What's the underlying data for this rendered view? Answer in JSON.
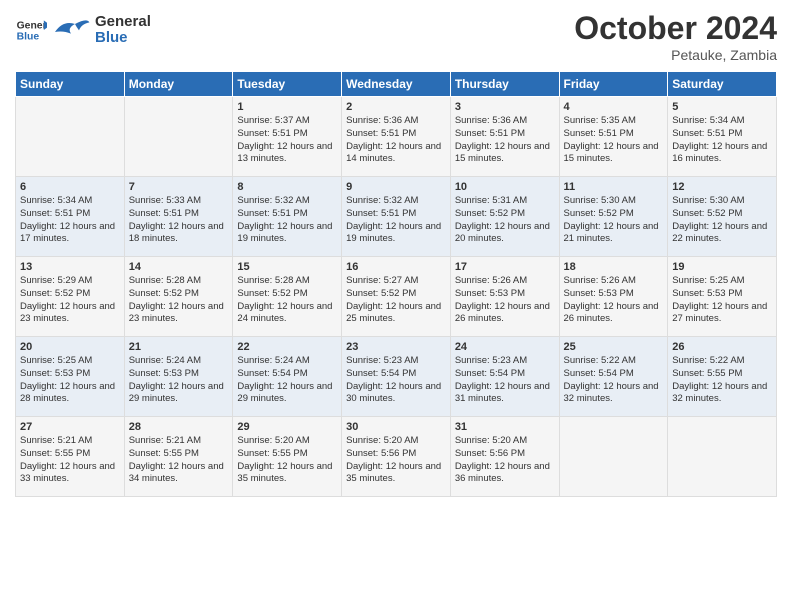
{
  "header": {
    "logo": {
      "line1": "General",
      "line2": "Blue"
    },
    "month": "October 2024",
    "location": "Petauke, Zambia"
  },
  "weekdays": [
    "Sunday",
    "Monday",
    "Tuesday",
    "Wednesday",
    "Thursday",
    "Friday",
    "Saturday"
  ],
  "weeks": [
    [
      {
        "day": "",
        "sunrise": "",
        "sunset": "",
        "daylight": ""
      },
      {
        "day": "",
        "sunrise": "",
        "sunset": "",
        "daylight": ""
      },
      {
        "day": "1",
        "sunrise": "Sunrise: 5:37 AM",
        "sunset": "Sunset: 5:51 PM",
        "daylight": "Daylight: 12 hours and 13 minutes."
      },
      {
        "day": "2",
        "sunrise": "Sunrise: 5:36 AM",
        "sunset": "Sunset: 5:51 PM",
        "daylight": "Daylight: 12 hours and 14 minutes."
      },
      {
        "day": "3",
        "sunrise": "Sunrise: 5:36 AM",
        "sunset": "Sunset: 5:51 PM",
        "daylight": "Daylight: 12 hours and 15 minutes."
      },
      {
        "day": "4",
        "sunrise": "Sunrise: 5:35 AM",
        "sunset": "Sunset: 5:51 PM",
        "daylight": "Daylight: 12 hours and 15 minutes."
      },
      {
        "day": "5",
        "sunrise": "Sunrise: 5:34 AM",
        "sunset": "Sunset: 5:51 PM",
        "daylight": "Daylight: 12 hours and 16 minutes."
      }
    ],
    [
      {
        "day": "6",
        "sunrise": "Sunrise: 5:34 AM",
        "sunset": "Sunset: 5:51 PM",
        "daylight": "Daylight: 12 hours and 17 minutes."
      },
      {
        "day": "7",
        "sunrise": "Sunrise: 5:33 AM",
        "sunset": "Sunset: 5:51 PM",
        "daylight": "Daylight: 12 hours and 18 minutes."
      },
      {
        "day": "8",
        "sunrise": "Sunrise: 5:32 AM",
        "sunset": "Sunset: 5:51 PM",
        "daylight": "Daylight: 12 hours and 19 minutes."
      },
      {
        "day": "9",
        "sunrise": "Sunrise: 5:32 AM",
        "sunset": "Sunset: 5:51 PM",
        "daylight": "Daylight: 12 hours and 19 minutes."
      },
      {
        "day": "10",
        "sunrise": "Sunrise: 5:31 AM",
        "sunset": "Sunset: 5:52 PM",
        "daylight": "Daylight: 12 hours and 20 minutes."
      },
      {
        "day": "11",
        "sunrise": "Sunrise: 5:30 AM",
        "sunset": "Sunset: 5:52 PM",
        "daylight": "Daylight: 12 hours and 21 minutes."
      },
      {
        "day": "12",
        "sunrise": "Sunrise: 5:30 AM",
        "sunset": "Sunset: 5:52 PM",
        "daylight": "Daylight: 12 hours and 22 minutes."
      }
    ],
    [
      {
        "day": "13",
        "sunrise": "Sunrise: 5:29 AM",
        "sunset": "Sunset: 5:52 PM",
        "daylight": "Daylight: 12 hours and 23 minutes."
      },
      {
        "day": "14",
        "sunrise": "Sunrise: 5:28 AM",
        "sunset": "Sunset: 5:52 PM",
        "daylight": "Daylight: 12 hours and 23 minutes."
      },
      {
        "day": "15",
        "sunrise": "Sunrise: 5:28 AM",
        "sunset": "Sunset: 5:52 PM",
        "daylight": "Daylight: 12 hours and 24 minutes."
      },
      {
        "day": "16",
        "sunrise": "Sunrise: 5:27 AM",
        "sunset": "Sunset: 5:52 PM",
        "daylight": "Daylight: 12 hours and 25 minutes."
      },
      {
        "day": "17",
        "sunrise": "Sunrise: 5:26 AM",
        "sunset": "Sunset: 5:53 PM",
        "daylight": "Daylight: 12 hours and 26 minutes."
      },
      {
        "day": "18",
        "sunrise": "Sunrise: 5:26 AM",
        "sunset": "Sunset: 5:53 PM",
        "daylight": "Daylight: 12 hours and 26 minutes."
      },
      {
        "day": "19",
        "sunrise": "Sunrise: 5:25 AM",
        "sunset": "Sunset: 5:53 PM",
        "daylight": "Daylight: 12 hours and 27 minutes."
      }
    ],
    [
      {
        "day": "20",
        "sunrise": "Sunrise: 5:25 AM",
        "sunset": "Sunset: 5:53 PM",
        "daylight": "Daylight: 12 hours and 28 minutes."
      },
      {
        "day": "21",
        "sunrise": "Sunrise: 5:24 AM",
        "sunset": "Sunset: 5:53 PM",
        "daylight": "Daylight: 12 hours and 29 minutes."
      },
      {
        "day": "22",
        "sunrise": "Sunrise: 5:24 AM",
        "sunset": "Sunset: 5:54 PM",
        "daylight": "Daylight: 12 hours and 29 minutes."
      },
      {
        "day": "23",
        "sunrise": "Sunrise: 5:23 AM",
        "sunset": "Sunset: 5:54 PM",
        "daylight": "Daylight: 12 hours and 30 minutes."
      },
      {
        "day": "24",
        "sunrise": "Sunrise: 5:23 AM",
        "sunset": "Sunset: 5:54 PM",
        "daylight": "Daylight: 12 hours and 31 minutes."
      },
      {
        "day": "25",
        "sunrise": "Sunrise: 5:22 AM",
        "sunset": "Sunset: 5:54 PM",
        "daylight": "Daylight: 12 hours and 32 minutes."
      },
      {
        "day": "26",
        "sunrise": "Sunrise: 5:22 AM",
        "sunset": "Sunset: 5:55 PM",
        "daylight": "Daylight: 12 hours and 32 minutes."
      }
    ],
    [
      {
        "day": "27",
        "sunrise": "Sunrise: 5:21 AM",
        "sunset": "Sunset: 5:55 PM",
        "daylight": "Daylight: 12 hours and 33 minutes."
      },
      {
        "day": "28",
        "sunrise": "Sunrise: 5:21 AM",
        "sunset": "Sunset: 5:55 PM",
        "daylight": "Daylight: 12 hours and 34 minutes."
      },
      {
        "day": "29",
        "sunrise": "Sunrise: 5:20 AM",
        "sunset": "Sunset: 5:55 PM",
        "daylight": "Daylight: 12 hours and 35 minutes."
      },
      {
        "day": "30",
        "sunrise": "Sunrise: 5:20 AM",
        "sunset": "Sunset: 5:56 PM",
        "daylight": "Daylight: 12 hours and 35 minutes."
      },
      {
        "day": "31",
        "sunrise": "Sunrise: 5:20 AM",
        "sunset": "Sunset: 5:56 PM",
        "daylight": "Daylight: 12 hours and 36 minutes."
      },
      {
        "day": "",
        "sunrise": "",
        "sunset": "",
        "daylight": ""
      },
      {
        "day": "",
        "sunrise": "",
        "sunset": "",
        "daylight": ""
      }
    ]
  ]
}
